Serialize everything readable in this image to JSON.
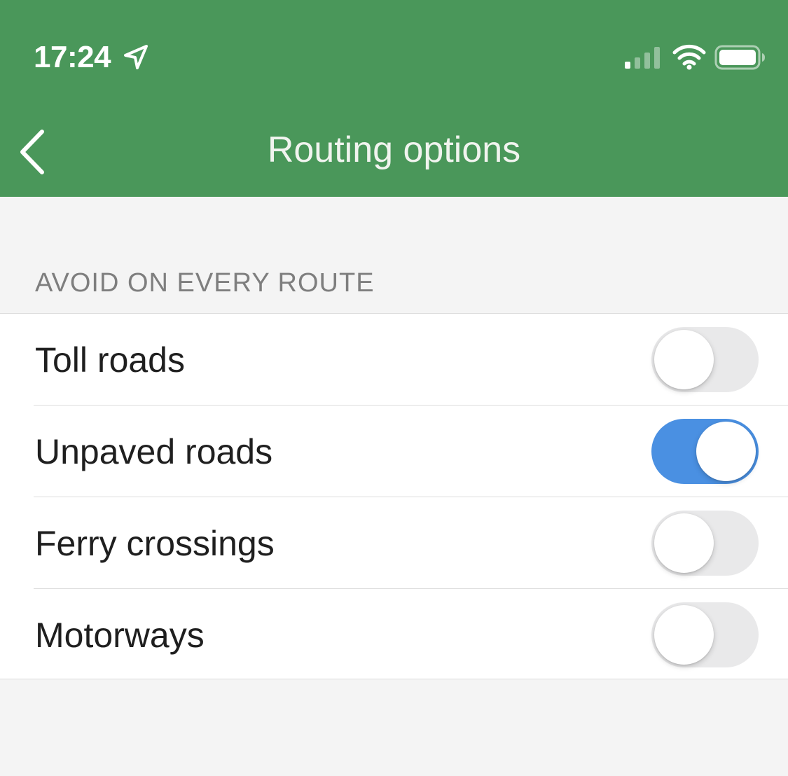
{
  "status_bar": {
    "time": "17:24",
    "icons": [
      "location-arrow-icon",
      "cellular-signal-icon",
      "wifi-icon",
      "battery-icon"
    ]
  },
  "nav": {
    "back_icon": "chevron-left-icon",
    "title": "Routing options"
  },
  "section": {
    "header": "AVOID ON EVERY ROUTE"
  },
  "options": [
    {
      "label": "Toll roads",
      "enabled": false
    },
    {
      "label": "Unpaved roads",
      "enabled": true
    },
    {
      "label": "Ferry crossings",
      "enabled": false
    },
    {
      "label": "Motorways",
      "enabled": false
    }
  ],
  "colors": {
    "header_bg": "#4a975a",
    "toggle_on": "#4a90e2",
    "toggle_off": "#e9e9ea",
    "page_bg": "#f4f4f4"
  }
}
